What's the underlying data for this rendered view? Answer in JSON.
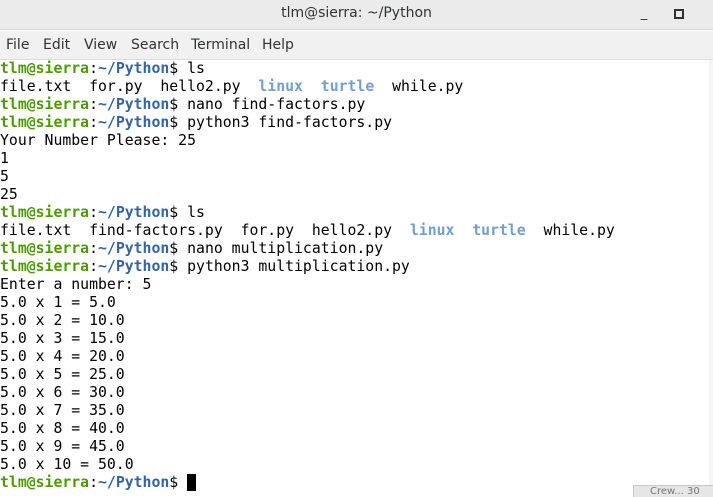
{
  "window": {
    "title": "tlm@sierra: ~/Python",
    "minimize_glyph": "_"
  },
  "menu": [
    "File",
    "Edit",
    "View",
    "Search",
    "Terminal",
    "Help"
  ],
  "prompt": {
    "user": "tlm@sierra",
    "sep": ":",
    "path": "~/Python",
    "symbol": "$ "
  },
  "terminal": {
    "lines": [
      "ls",
      [
        "file.txt",
        "for.py",
        "hello2.py",
        "linux",
        "turtle",
        "while.py"
      ],
      "nano find-factors.py",
      "python3 find-factors.py",
      "Your Number Please: 25",
      "1",
      "5",
      "25",
      "ls",
      [
        "file.txt",
        "find-factors.py",
        "for.py",
        "hello2.py",
        "linux",
        "turtle",
        "while.py"
      ],
      "nano multiplication.py",
      "python3 multiplication.py",
      "Enter a number: 5",
      "5.0 x 1 = 5.0",
      "5.0 x 2 = 10.0",
      "5.0 x 3 = 15.0",
      "5.0 x 4 = 20.0",
      "5.0 x 5 = 25.0",
      "5.0 x 6 = 30.0",
      "5.0 x 7 = 35.0",
      "5.0 x 8 = 40.0",
      "5.0 x 9 = 45.0",
      "5.0 x 10 = 50.0"
    ]
  },
  "background_window": {
    "text": "Crew... 30"
  },
  "colors": {
    "prompt_user": "#4e9a06",
    "prompt_path": "#3465a4",
    "directory": "#729fcf"
  }
}
